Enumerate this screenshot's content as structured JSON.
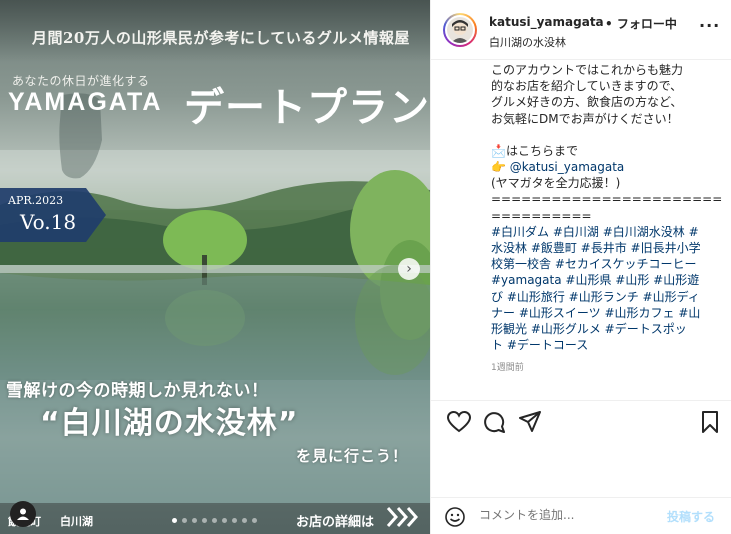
{
  "image": {
    "tagline": "月間20万人の山形県民が参考にしているグルメ情報屋",
    "sub_serif": "あなたの休日が進化する",
    "brand": "YAMAGATA",
    "brand_suffix": "デートプラン",
    "issue_date": "APR.2023",
    "issue_vol": "Vo.18",
    "headline_line1": "雪解けの今の時期しか見れない！",
    "headline_line2": "“白川湖の水没林”",
    "headline_line3": "を見に行こう！",
    "location_1": "飯豊町",
    "location_2": "白川湖",
    "details_label": "お店の詳細は",
    "carousel_total": 9,
    "carousel_active": 1
  },
  "header": {
    "username": "katusi_yamagata",
    "follow_label": "• フォロー中",
    "place": "白川湖の水没林",
    "more_icon": "more-horizontal-icon"
  },
  "caption": {
    "intro_lines": [
      "このアカウントではこれからも魅力",
      "的なお店を紹介していきますので、",
      "グルメ好きの方、飲食店の方など、",
      "お気軽にDMでお声がけください！"
    ],
    "contact_line": "📩はこちらまで",
    "pointer_prefix": "👉 ",
    "mention": "@katusi_yamagata",
    "support_line": "(ヤマガタを全力応援！)",
    "divider1": "=========================",
    "divider2": "==========",
    "hashtags": [
      "#白川ダム #白川湖 #白川湖水没林 #",
      "水没林 #飯豊町 #長井市 #旧長井小学",
      "校第一校舎 #セカイスケッチコーヒー",
      "#yamagata #山形県 #山形 #山形遊",
      "び #山形旅行 #山形ランチ #山形ディ",
      "ナー #山形スイーツ #山形カフェ #山",
      "形観光 #山形グルメ #デートスポッ",
      "ト #デートコース"
    ],
    "time_ago": "1週間前"
  },
  "actions": {
    "like_icon": "heart-icon",
    "comment_icon": "comment-icon",
    "share_icon": "send-icon",
    "save_icon": "bookmark-icon"
  },
  "footer": {
    "comment_placeholder": "コメントを追加...",
    "post_label": "投稿する"
  },
  "colors": {
    "link": "#00376b",
    "muted": "#8e8e8e",
    "post_disabled": "#b2dffc",
    "issue_banner": "#1f3d6b"
  }
}
